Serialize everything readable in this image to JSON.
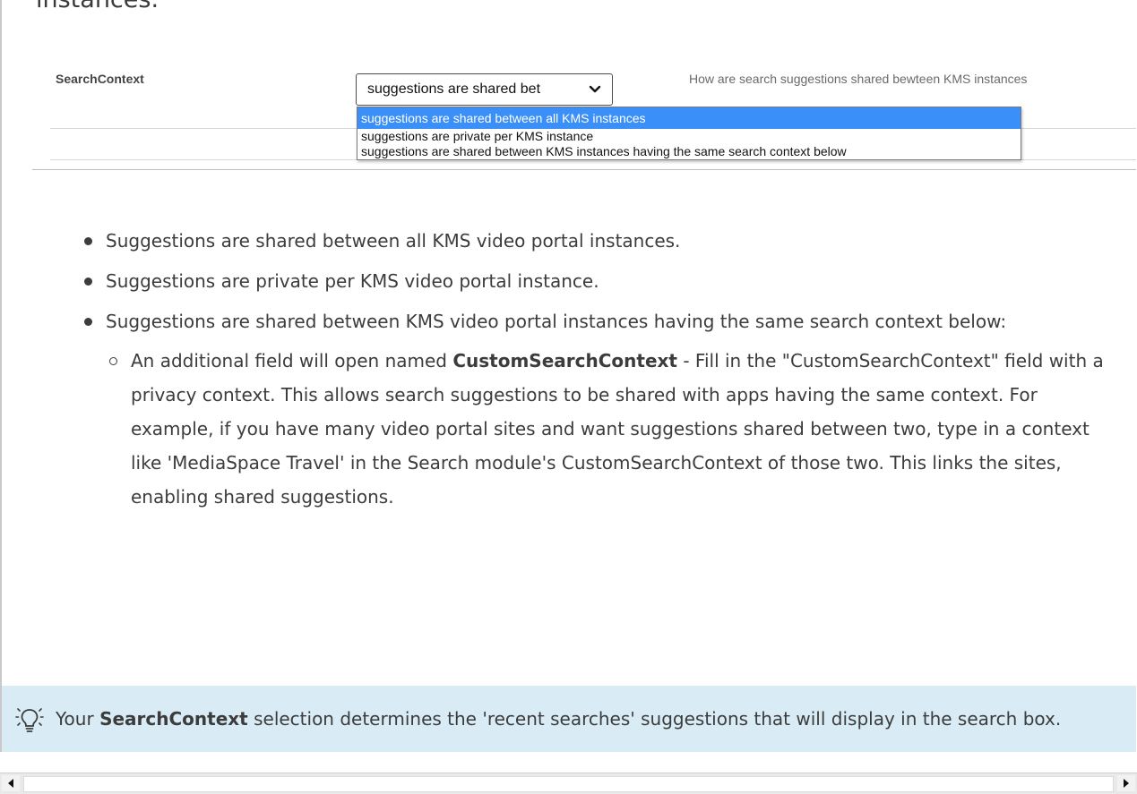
{
  "intro_fragment": "instances.",
  "settings_shot": {
    "field_label": "SearchContext",
    "select_value": "suggestions are shared bet",
    "field_description": "How are search suggestions shared bewteen KMS instances",
    "options": [
      "suggestions are shared between all KMS instances",
      "suggestions are private per KMS instance",
      "suggestions are shared between KMS instances having the same search context below"
    ]
  },
  "bullets": [
    "Suggestions are shared between all KMS video portal instances.",
    "Suggestions are private per KMS video portal instance.",
    "Suggestions are shared between KMS video portal instances having the same search context below:"
  ],
  "sub_bullet": {
    "prefix": "An additional field will open named ",
    "bold": "CustomSearchContext",
    "rest": " - Fill in the \"CustomSearchContext\" field with a privacy context. This allows search suggestions to be shared with apps having the same context. For example, if you have many video portal sites and want suggestions shared between two, type in a context like 'MediaSpace Travel' in the Search module's CustomSearchContext of those two. This links the sites, enabling shared suggestions."
  },
  "tip": {
    "prefix": "Your ",
    "bold": "SearchContext",
    "rest": " selection determines the 'recent searches' suggestions that will display in the search box."
  },
  "icons": {
    "select_chevron": "chevron-down-icon",
    "tip": "lightbulb-icon",
    "scroll_left": "arrow-left-icon",
    "scroll_right": "arrow-right-icon"
  },
  "colors": {
    "tip_background": "#d9ecf6",
    "selected_option": "#3b8ff8"
  }
}
